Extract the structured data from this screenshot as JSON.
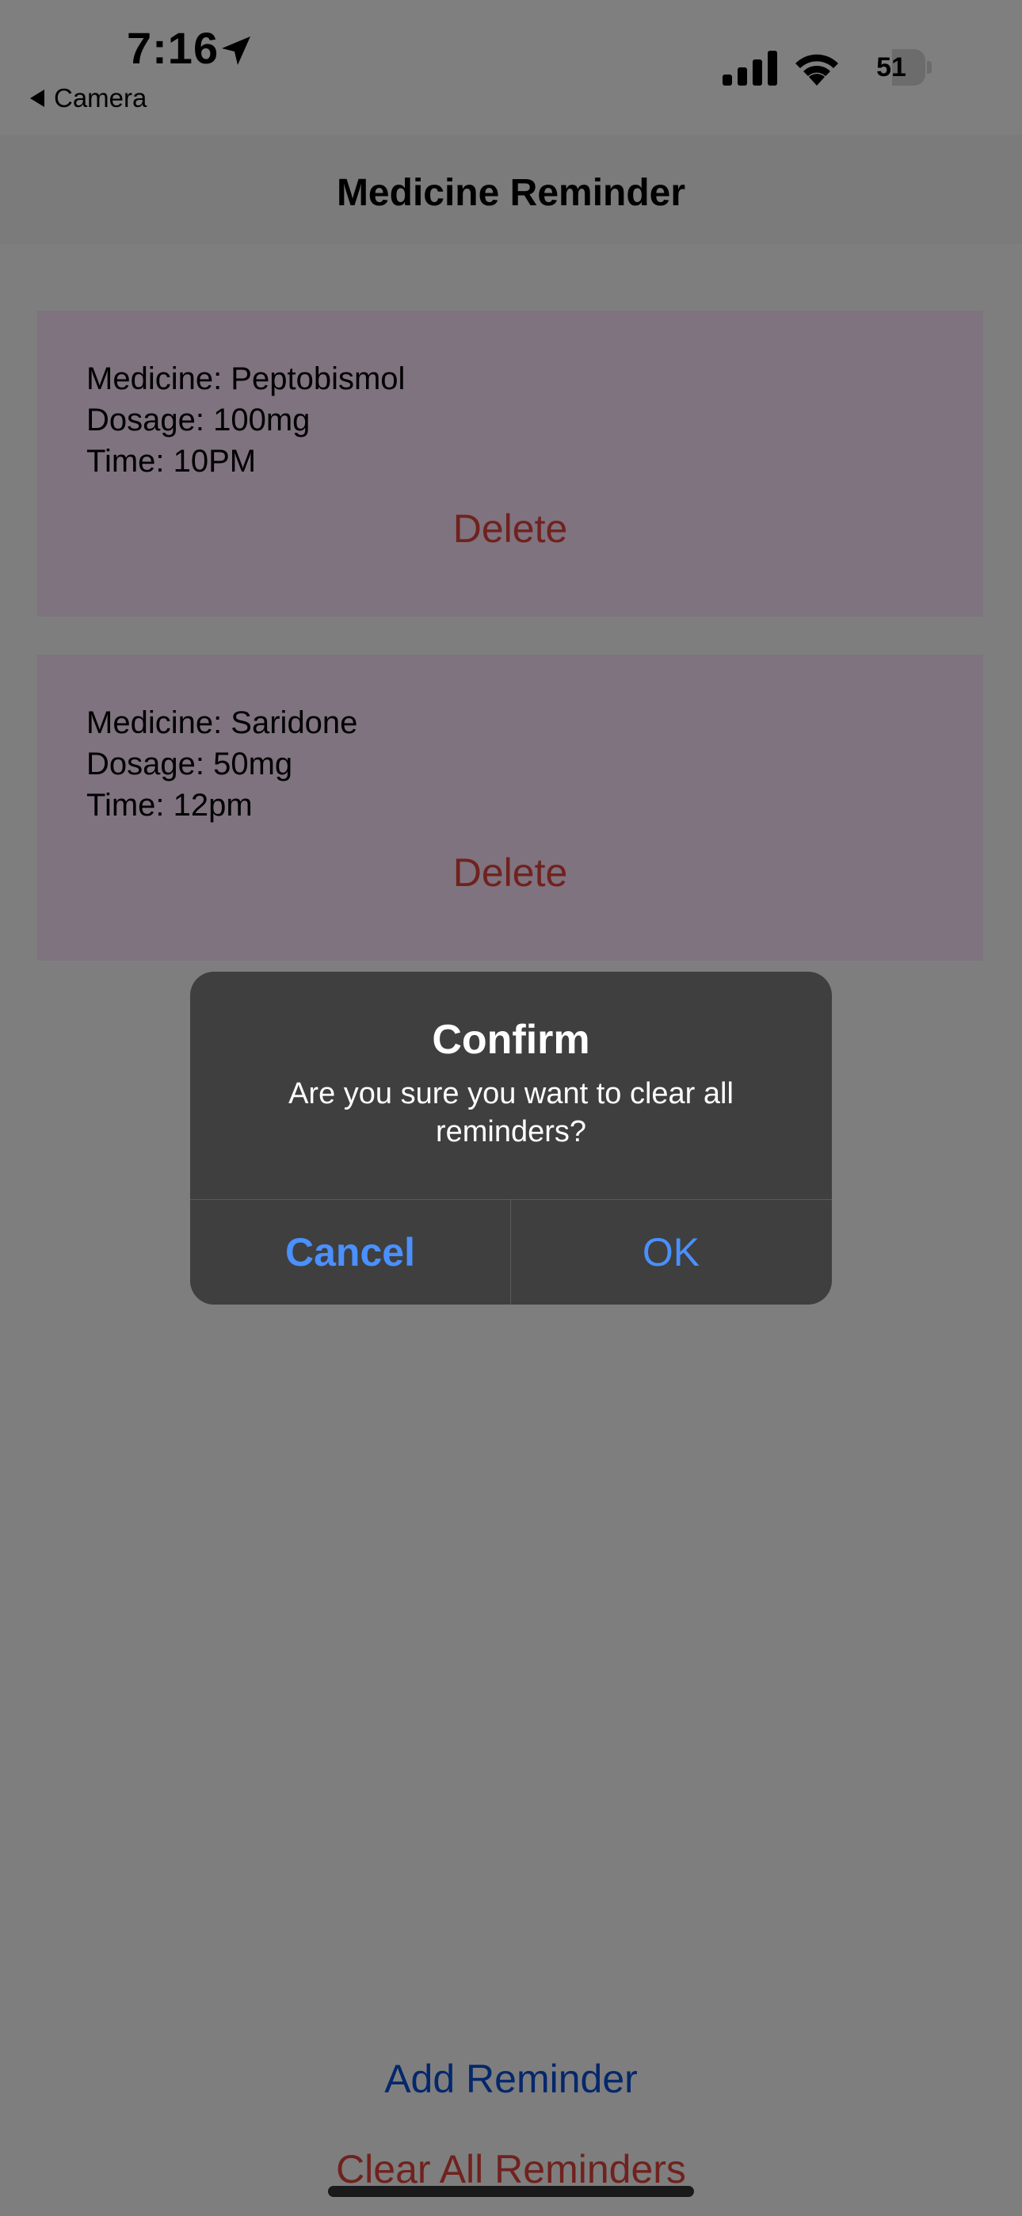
{
  "status_bar": {
    "time": "7:16",
    "back_app": "Camera",
    "battery_level": "51",
    "battery_fraction": 0.51,
    "icons": [
      "location-arrow-icon",
      "cellular-signal-icon",
      "wifi-icon",
      "battery-icon",
      "back-triangle-icon"
    ]
  },
  "nav": {
    "title": "Medicine Reminder"
  },
  "reminders": [
    {
      "medicine": "Medicine: Peptobismol",
      "dosage": "Dosage: 100mg",
      "time": "Time: 10PM",
      "delete_label": "Delete"
    },
    {
      "medicine": "Medicine: Saridone",
      "dosage": "Dosage: 50mg",
      "time": "Time: 12pm",
      "delete_label": "Delete"
    }
  ],
  "actions": {
    "add_label": "Add Reminder",
    "clear_label": "Clear All Reminders"
  },
  "alert": {
    "title": "Confirm",
    "message": "Are you sure you want to clear all reminders?",
    "cancel_label": "Cancel",
    "ok_label": "OK"
  },
  "colors": {
    "card_background": "#ffe6ff",
    "destructive": "#e0443c",
    "link": "#0a4fd6",
    "alert_button": "#4a90ff",
    "alert_background": "#3f3f3f"
  }
}
